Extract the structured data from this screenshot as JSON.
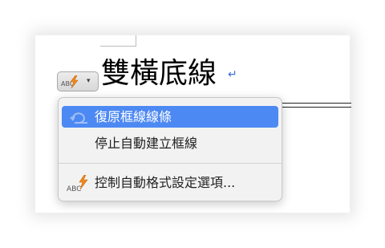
{
  "document": {
    "heading": "雙橫底線",
    "return_mark": "↵"
  },
  "autocorrect_button": {
    "icon_text": "ABC",
    "arrow": "▾",
    "icon": "autocorrect-lightning-icon"
  },
  "menu": {
    "items": [
      {
        "label": "復原框線線條",
        "icon": "undo-icon",
        "active": true
      },
      {
        "label": "停止自動建立框線",
        "icon": null,
        "active": false
      },
      {
        "label": "控制自動格式設定選項...",
        "icon": "autocorrect-lightning-icon",
        "active": false
      }
    ]
  },
  "colors": {
    "accent": "#4d89f3",
    "lightning": "#f08a1c",
    "return_mark": "#3a6fd6"
  }
}
